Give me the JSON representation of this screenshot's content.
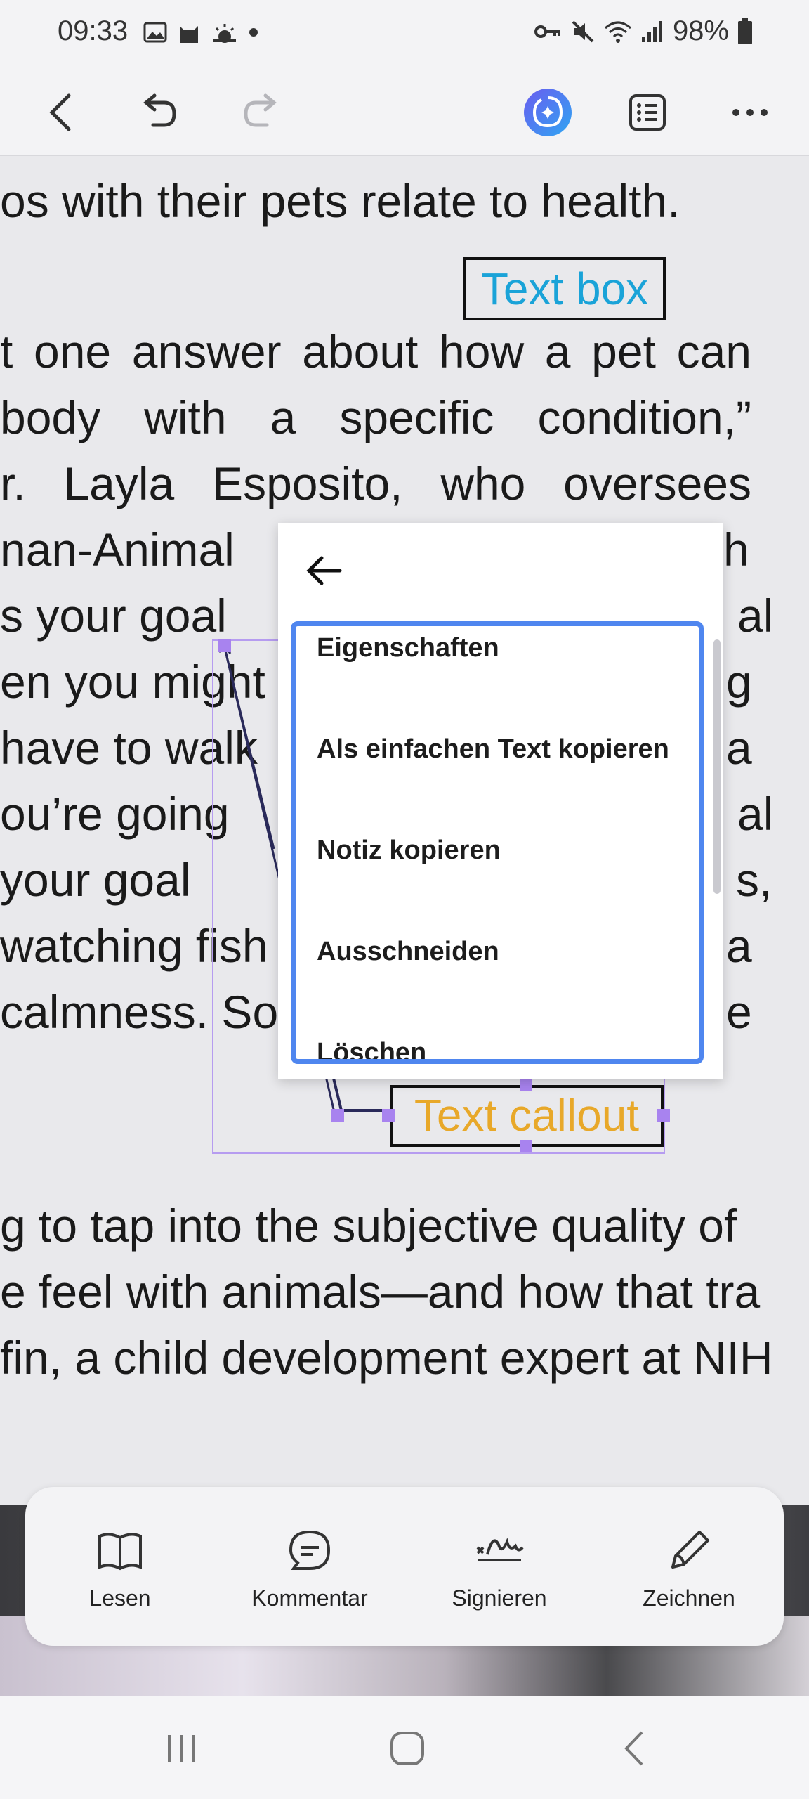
{
  "status_bar": {
    "time": "09:33",
    "battery": "98%",
    "left_icons": [
      "gallery-icon",
      "cat-icon",
      "weather-icon",
      "dot-icon"
    ],
    "right_icons": [
      "key-icon",
      "mute-icon",
      "wifi-icon",
      "signal-icon",
      "battery-icon"
    ]
  },
  "toolbar": {
    "buttons": [
      "back-icon",
      "undo-icon",
      "redo-icon",
      "ai-assistant-icon",
      "list-view-icon",
      "more-icon"
    ]
  },
  "document": {
    "lines": [
      "os with their pets relate to health.",
      "t one answer about how a pet can",
      "body with a specific condition,”",
      "r. Layla Esposito, who oversees",
      "nan-Animal",
      "s your goal",
      "en you might",
      "have to walk",
      "ou’re going",
      " your goal",
      " watching fish",
      "calmness. So",
      "g to tap into the subjective quality of",
      "e feel with animals—and how that tra",
      "fin, a child development expert at NIH"
    ],
    "right_fragments": [
      "h",
      "al",
      "g",
      "a",
      "al",
      "s,",
      "a",
      "e"
    ],
    "text_box_label": "Text box",
    "callout_label": "Text callout"
  },
  "context_menu": {
    "items": [
      "Eigenschaften",
      "Als einfachen Text kopieren",
      "Notiz kopieren",
      "Ausschneiden",
      "Löschen"
    ]
  },
  "bottom_tools": {
    "items": [
      {
        "label": "Lesen",
        "icon": "book-icon"
      },
      {
        "label": "Kommentar",
        "icon": "comment-icon"
      },
      {
        "label": "Signieren",
        "icon": "signature-icon"
      },
      {
        "label": "Zeichnen",
        "icon": "pen-icon"
      }
    ]
  },
  "colors": {
    "accent_blue": "#4f86ef",
    "text_box_color": "#1aa3d8",
    "callout_color": "#e8a829",
    "selection_purple": "#a883ef"
  }
}
